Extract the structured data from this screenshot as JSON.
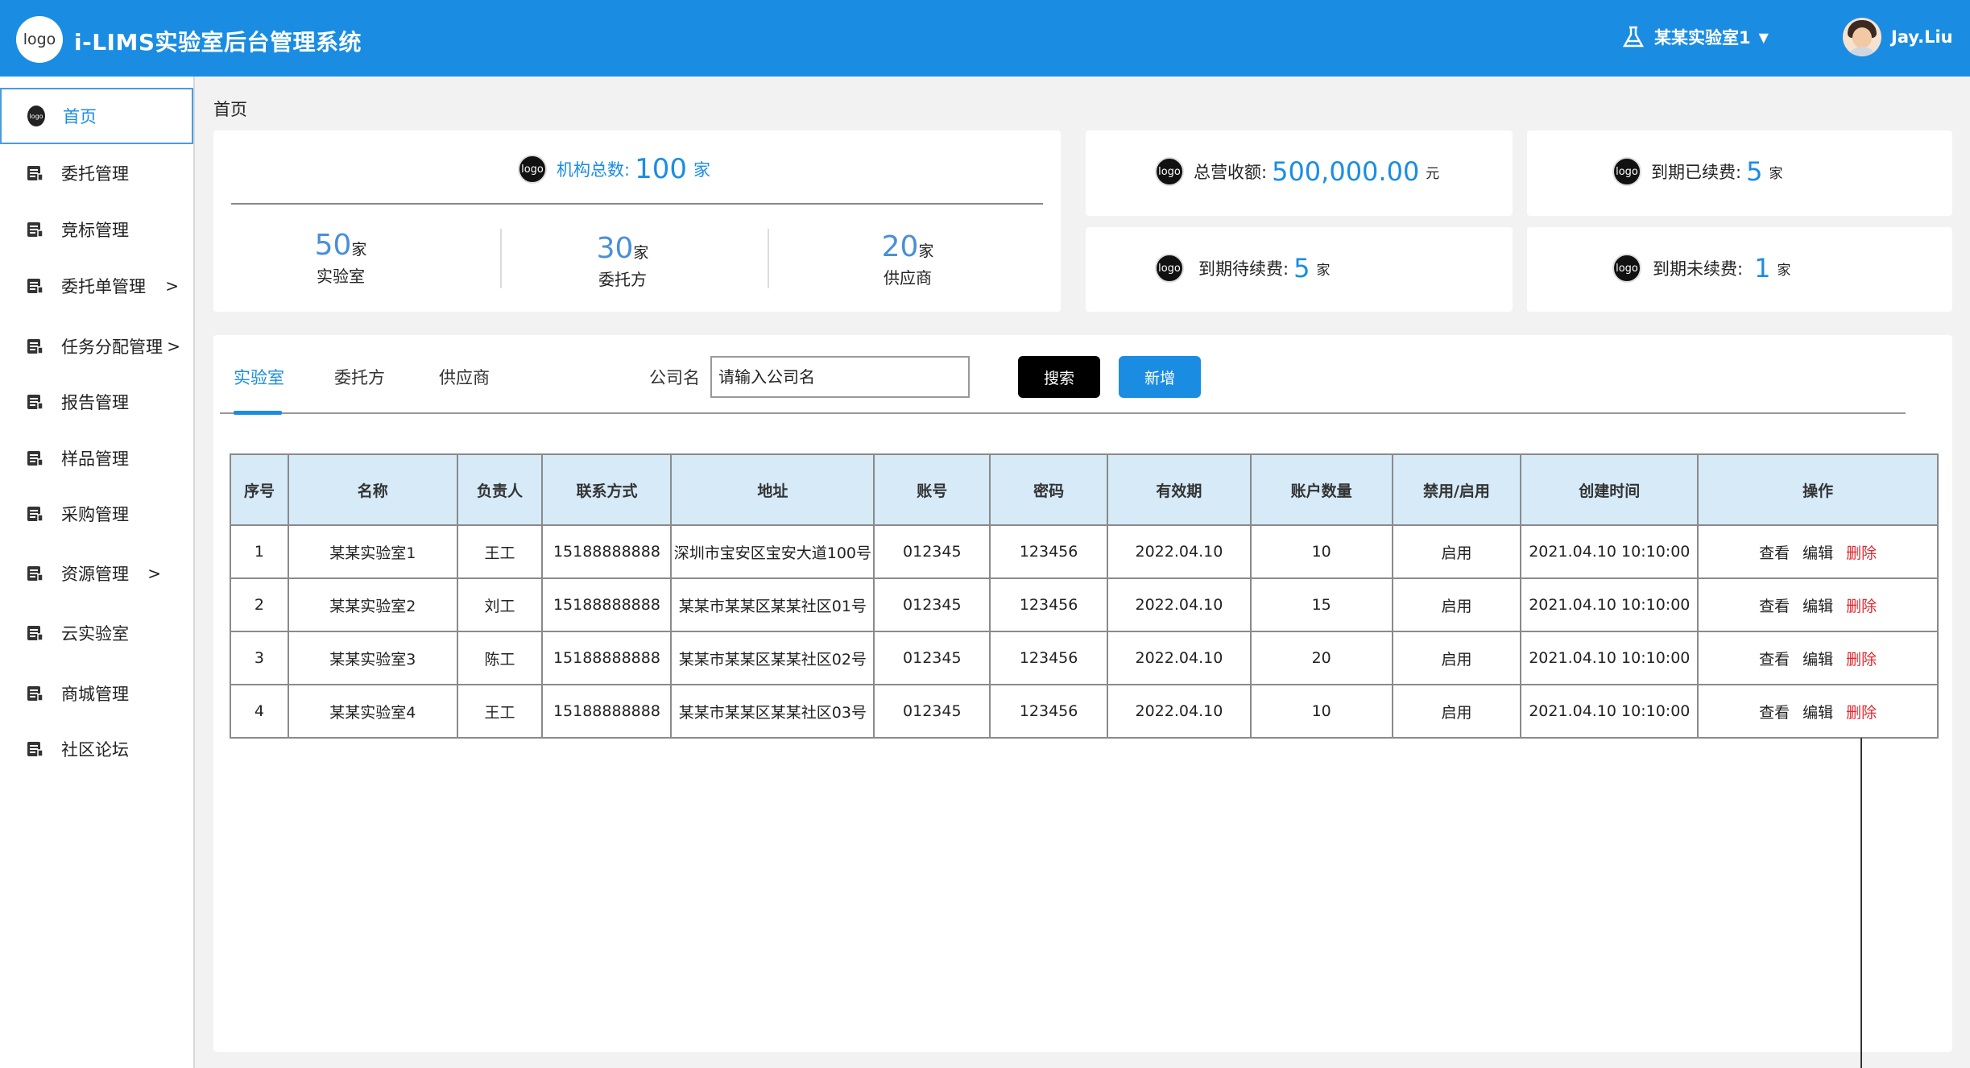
{
  "header": {
    "logo_text": "logo",
    "title": "i-LIMS实验室后台管理系统",
    "lab_selector": "某某实验室1",
    "user_name": "Jay.Liu"
  },
  "sidebar": {
    "items": [
      {
        "label": "首页",
        "has_arrow": false
      },
      {
        "label": "委托管理",
        "has_arrow": false
      },
      {
        "label": "竞标管理",
        "has_arrow": false
      },
      {
        "label": "委托单管理",
        "has_arrow": true
      },
      {
        "label": "任务分配管理",
        "has_arrow": true
      },
      {
        "label": "报告管理",
        "has_arrow": false
      },
      {
        "label": "样品管理",
        "has_arrow": false
      },
      {
        "label": "采购管理",
        "has_arrow": false
      },
      {
        "label": "资源管理",
        "has_arrow": true
      },
      {
        "label": "云实验室",
        "has_arrow": false
      },
      {
        "label": "商城管理",
        "has_arrow": false
      },
      {
        "label": "社区论坛",
        "has_arrow": false
      }
    ],
    "arrow": ">",
    "mini_logo": "logo"
  },
  "breadcrumb": "首页",
  "stats": {
    "org_total": {
      "label": "机构总数:",
      "value": "100",
      "unit": "家"
    },
    "labs": {
      "value": "50",
      "unit": "家",
      "label": "实验室"
    },
    "clients": {
      "value": "30",
      "unit": "家",
      "label": "委托方"
    },
    "suppliers": {
      "value": "20",
      "unit": "家",
      "label": "供应商"
    },
    "revenue": {
      "label": "总营收额:",
      "value": "500,000.00",
      "unit": "元"
    },
    "renewed": {
      "label": "到期已续费:",
      "value": "5",
      "unit": "家"
    },
    "pending": {
      "label": "到期待续费:",
      "value": "5",
      "unit": "家"
    },
    "not_renewed": {
      "label": "到期未续费:",
      "value": "1",
      "unit": "家"
    },
    "logo_text": "logo"
  },
  "tabs": [
    "实验室",
    "委托方",
    "供应商"
  ],
  "search": {
    "label": "公司名",
    "placeholder": "请输入公司名",
    "search_button": "搜索",
    "add_button": "新增"
  },
  "table": {
    "headers": [
      "序号",
      "名称",
      "负责人",
      "联系方式",
      "地址",
      "账号",
      "密码",
      "有效期",
      "账户数量",
      "禁用/启用",
      "创建时间",
      "操作"
    ],
    "rows": [
      [
        "1",
        "某某实验室1",
        "王工",
        "15188888888",
        "深圳市宝安区宝安大道100号",
        "012345",
        "123456",
        "2022.04.10",
        "10",
        "启用",
        "2021.04.10 10:10:00"
      ],
      [
        "2",
        "某某实验室2",
        "刘工",
        "15188888888",
        "某某市某某区某某社区01号",
        "012345",
        "123456",
        "2022.04.10",
        "15",
        "启用",
        "2021.04.10 10:10:00"
      ],
      [
        "3",
        "某某实验室3",
        "陈工",
        "15188888888",
        "某某市某某区某某社区02号",
        "012345",
        "123456",
        "2022.04.10",
        "20",
        "启用",
        "2021.04.10 10:10:00"
      ],
      [
        "4",
        "某某实验室4",
        "王工",
        "15188888888",
        "某某市某某区某某社区03号",
        "012345",
        "123456",
        "2022.04.10",
        "10",
        "启用",
        "2021.04.10 10:10:00"
      ]
    ],
    "actions": {
      "view": "查看",
      "edit": "编辑",
      "delete": "删除"
    }
  },
  "colors": {
    "primary": "#1a8de3",
    "danger": "#e0282e",
    "table_header": "#d6eaf8"
  }
}
